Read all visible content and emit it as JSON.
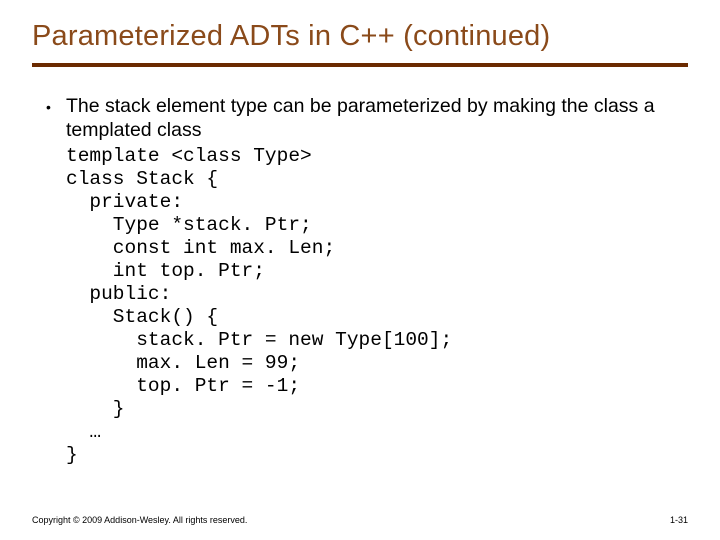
{
  "title": "Parameterized ADTs in C++ (continued)",
  "bullet": {
    "text": "The stack element type can be parameterized by making the class a templated class"
  },
  "code": "template <class Type>\nclass Stack {\n  private:\n    Type *stack. Ptr;\n    const int max. Len;\n    int top. Ptr;\n  public:\n    Stack() {\n      stack. Ptr = new Type[100];\n      max. Len = 99;\n      top. Ptr = -1;\n    }\n  …\n}",
  "footer": {
    "copyright": "Copyright © 2009 Addison-Wesley. All rights reserved.",
    "page": "1-31"
  }
}
